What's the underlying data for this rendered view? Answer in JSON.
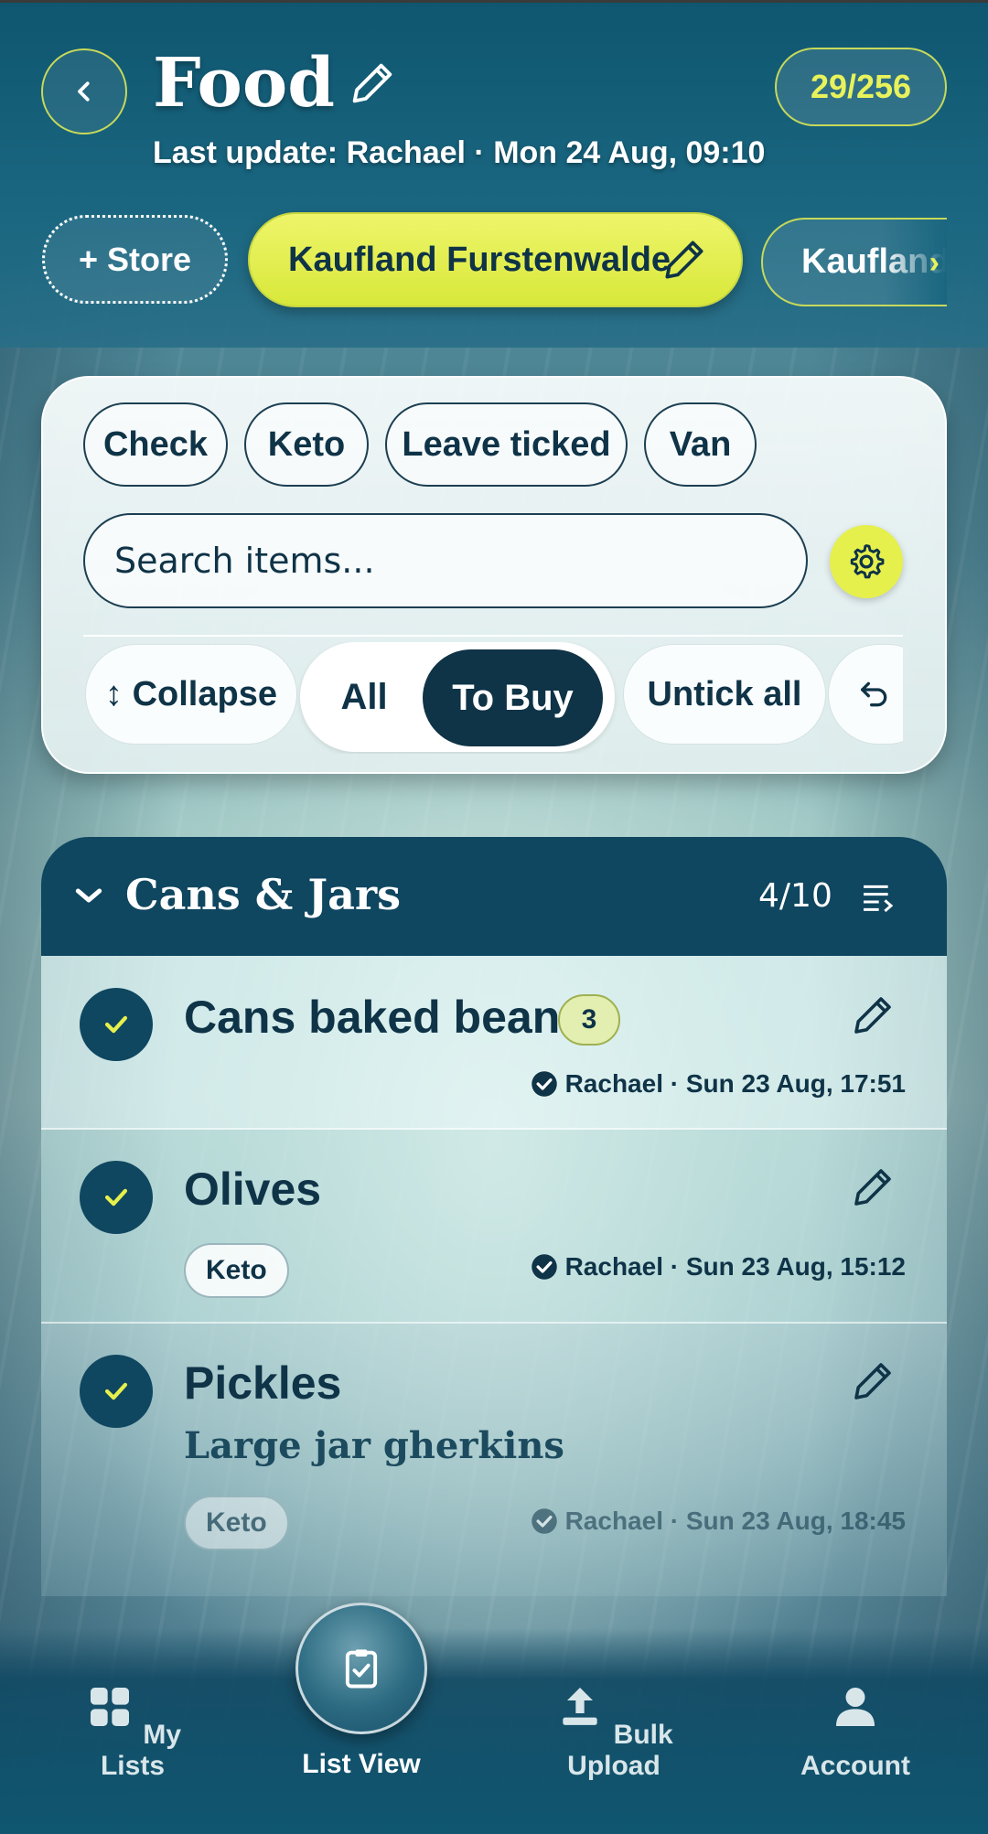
{
  "header": {
    "title": "Food",
    "subtitle": "Last update: Rachael · Mon 24 Aug, 09:10",
    "progress": "29/256"
  },
  "stores": {
    "add_label": "+ Store",
    "items": [
      {
        "label": "Kaufland Furstenwalde",
        "active": true
      },
      {
        "label": "Kaufland",
        "active": false
      }
    ]
  },
  "filters": {
    "tags": [
      "Check",
      "Keto",
      "Leave ticked",
      "Van"
    ],
    "search_placeholder": "Search items...",
    "actions": {
      "collapse": "↕ Collapse",
      "all": "All",
      "to_buy": "To Buy",
      "untick_all": "Untick all",
      "undo_icon": "undo-icon"
    }
  },
  "category": {
    "title": "Cans & Jars",
    "count": "4/10",
    "items": [
      {
        "name": "Cans baked beans",
        "qty": "3",
        "meta": "Rachael · Sun 23 Aug, 17:51",
        "checked": true
      },
      {
        "name": "Olives",
        "tag": "Keto",
        "meta": "Rachael · Sun 23 Aug, 15:12",
        "checked": true
      },
      {
        "name": "Pickles",
        "note": "Large jar gherkins",
        "tag": "Keto",
        "meta": "Rachael · Sun 23 Aug, 18:45",
        "checked": true
      }
    ]
  },
  "nav": {
    "my_lists": "My Lists",
    "list_view": "List View",
    "bulk_upload": "Bulk Upload",
    "account": "Account"
  },
  "colors": {
    "accent": "#e6f04c",
    "primary_dark": "#0f3347",
    "header_bg": "#0f5670"
  }
}
